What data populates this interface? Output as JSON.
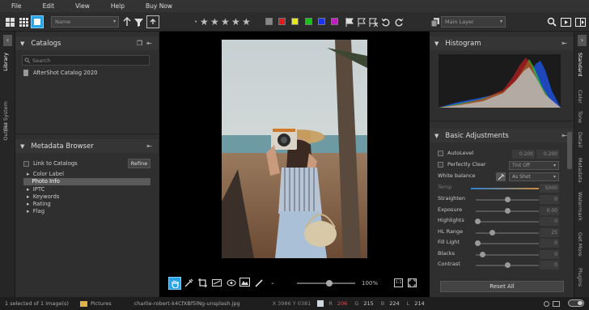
{
  "menu": [
    "File",
    "Edit",
    "View",
    "Help",
    "Buy Now"
  ],
  "toolbar": {
    "name_select": "Name",
    "layer_select": "Main Layer",
    "stars": [
      "★",
      "★",
      "★",
      "★",
      "★"
    ],
    "color_labels": [
      "#888888",
      "#e01b1b",
      "#e8e817",
      "#18c218",
      "#1c34e8",
      "#c01ec0"
    ]
  },
  "left_tabs": [
    "Library",
    "File System",
    "Output"
  ],
  "catalogs": {
    "title": "Catalogs",
    "search_placeholder": "Search",
    "items": [
      "AfterShot Catalog 2020"
    ]
  },
  "metadata": {
    "title": "Metadata Browser",
    "link_label": "Link to Catalogs",
    "refine": "Refine",
    "items": [
      "Color Label",
      "Photo Info",
      "IPTC",
      "Keywords",
      "Rating",
      "Flag"
    ],
    "selected": "Photo Info"
  },
  "viewer": {
    "zoom": "100%"
  },
  "histogram": {
    "title": "Histogram"
  },
  "adjust": {
    "title": "Basic Adjustments",
    "autolevel": "AutoLevel",
    "autolevel_v1": "0.200",
    "autolevel_v2": "0.200",
    "perfectly_clear": "Perfectly Clear",
    "tint": "Tint Off",
    "white_balance": "White balance",
    "wb_mode": "As Shot",
    "temp_label": "Temp",
    "temp_value": "5000",
    "sliders": [
      {
        "label": "Straighten",
        "value": "0",
        "pos": 0.5
      },
      {
        "label": "Exposure",
        "value": "0.00",
        "pos": 0.5
      },
      {
        "label": "Highlights",
        "value": "0",
        "pos": 0.02
      },
      {
        "label": "HL Range",
        "value": "25",
        "pos": 0.25
      },
      {
        "label": "Fill Light",
        "value": "0",
        "pos": 0.02
      },
      {
        "label": "Blacks",
        "value": "0",
        "pos": 0.1
      },
      {
        "label": "Contrast",
        "value": "0",
        "pos": 0.5
      }
    ],
    "reset": "Reset All"
  },
  "right_tabs": [
    "Standard",
    "Color",
    "Tone",
    "Detail",
    "Metadata",
    "Watermark",
    "Get More",
    "Plugins"
  ],
  "status": {
    "selected": "1 selected of 1 image(s)",
    "folder": "Pictures",
    "file": "charlie-robert-k4CfXBf5lNg-unsplash.jpg",
    "coords": "X 3986  Y 0381",
    "r_label": "R",
    "r": "206",
    "g_label": "G",
    "g": "215",
    "b_label": "B",
    "b": "224",
    "l_label": "L",
    "l": "214"
  }
}
